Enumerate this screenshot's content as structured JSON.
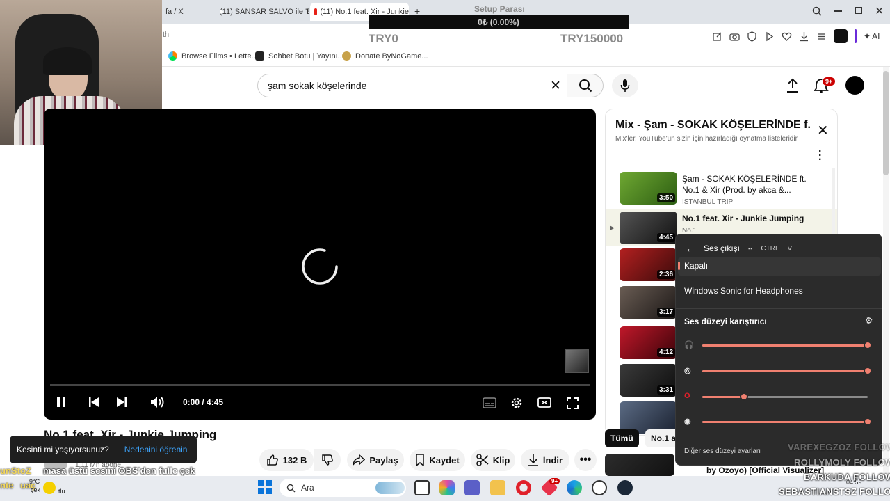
{
  "browser": {
    "tabs": [
      {
        "label": "fa / X"
      },
      {
        "label": "(11) SANSAR SALVO ile 'E"
      },
      {
        "label": "(11) No.1 feat. Xir - Junkie"
      }
    ],
    "address_fragment": "th",
    "bookmarks": [
      "Browse Films • Lette...",
      "Sohbet Botu | Yayını...",
      "Donate ByNoGame..."
    ],
    "ai_label": "AI"
  },
  "stream_overlay": {
    "goal_title": "Setup Parası",
    "goal_progress": "0₺ (0.00%)",
    "goal_min": "TRY0",
    "goal_max": "TRY150000",
    "goal_fraction": 0.0
  },
  "youtube": {
    "search_value": "şam sokak köşelerinde",
    "notification_badge": "9+",
    "player": {
      "time": "0:00 / 4:45",
      "progress_fraction": 0.0
    },
    "video_title": "No.1 feat. Xir - Junkie Jumping",
    "subscribers": "1,11 Mn abone",
    "actions": {
      "like_count": "132 B",
      "share": "Paylaş",
      "save": "Kaydet",
      "clip": "Klip",
      "download": "İndir"
    },
    "lag_toast": {
      "question": "Kesinti mi yaşıyorsunuz?",
      "link": "Nedenini öğrenin"
    },
    "chips": {
      "all": "Tümü",
      "no1": "No.1 a"
    },
    "playlist": {
      "title": "Mix - Şam - SOKAK KÖŞELERİNDE f...",
      "subtitle": "Mix'ler, YouTube'un sizin için hazırladığı oynatma listeleridir",
      "items": [
        {
          "title": "Şam - SOKAK KÖŞELERİNDE ft. No.1 & Xir (Prod. by akca &...",
          "channel": "ISTANBUL TRIP",
          "duration": "3:50"
        },
        {
          "title": "No.1 feat. Xir - Junkie Jumping",
          "channel": "No.1",
          "duration": "4:45"
        },
        {
          "title": "",
          "channel": "",
          "duration": "2:36"
        },
        {
          "title": "",
          "channel": "",
          "duration": "3:17"
        },
        {
          "title": "",
          "channel": "",
          "duration": "4:12"
        },
        {
          "title": "",
          "channel": "",
          "duration": "3:31"
        }
      ],
      "below_text": "by Ozoyo) [Official Visualizer]"
    }
  },
  "audio_panel": {
    "header": "Ses çıkışı",
    "shortcut": "CTRL",
    "shortcut_key": "V",
    "option_off": "Kapalı",
    "option_sonic": "Windows Sonic for Headphones",
    "mixer_title": "Ses düzeyi karıştırıcı",
    "more_settings": "Diğer ses düzeyi ayarları",
    "levels": [
      {
        "app": "headphones-icon",
        "level": 1.0
      },
      {
        "app": "system-sounds-icon",
        "level": 1.0
      },
      {
        "app": "opera-icon",
        "level": 0.25
      },
      {
        "app": "steam-icon",
        "level": 1.0
      }
    ]
  },
  "chat_overlay": {
    "line": "masa üstü sesini OBS'den fulle çek",
    "user_fragment": "unStoZ",
    "user2_fragment": "nte",
    "user2_fragment_b": "uaç",
    "weather_bits": "çek",
    "tlu": "tlu"
  },
  "follow_alerts": [
    {
      "name": "VAREXEGZOZ",
      "label": "FOLLOW"
    },
    {
      "name": "ROLLYMOLY",
      "label": "FOLLOW"
    },
    {
      "name": "BARKUDA",
      "label": "FOLLOW"
    },
    {
      "name": "SEBASTIANSTSZ",
      "label": "FOLLOW"
    }
  ],
  "taskbar": {
    "temperature": "9°C",
    "search_label": "Ara",
    "time": "04:59",
    "badge": "9+"
  },
  "colors": {
    "accent_slider": "#f08070",
    "yt_red": "#e62117",
    "panel_bg": "#2b2b2b"
  }
}
